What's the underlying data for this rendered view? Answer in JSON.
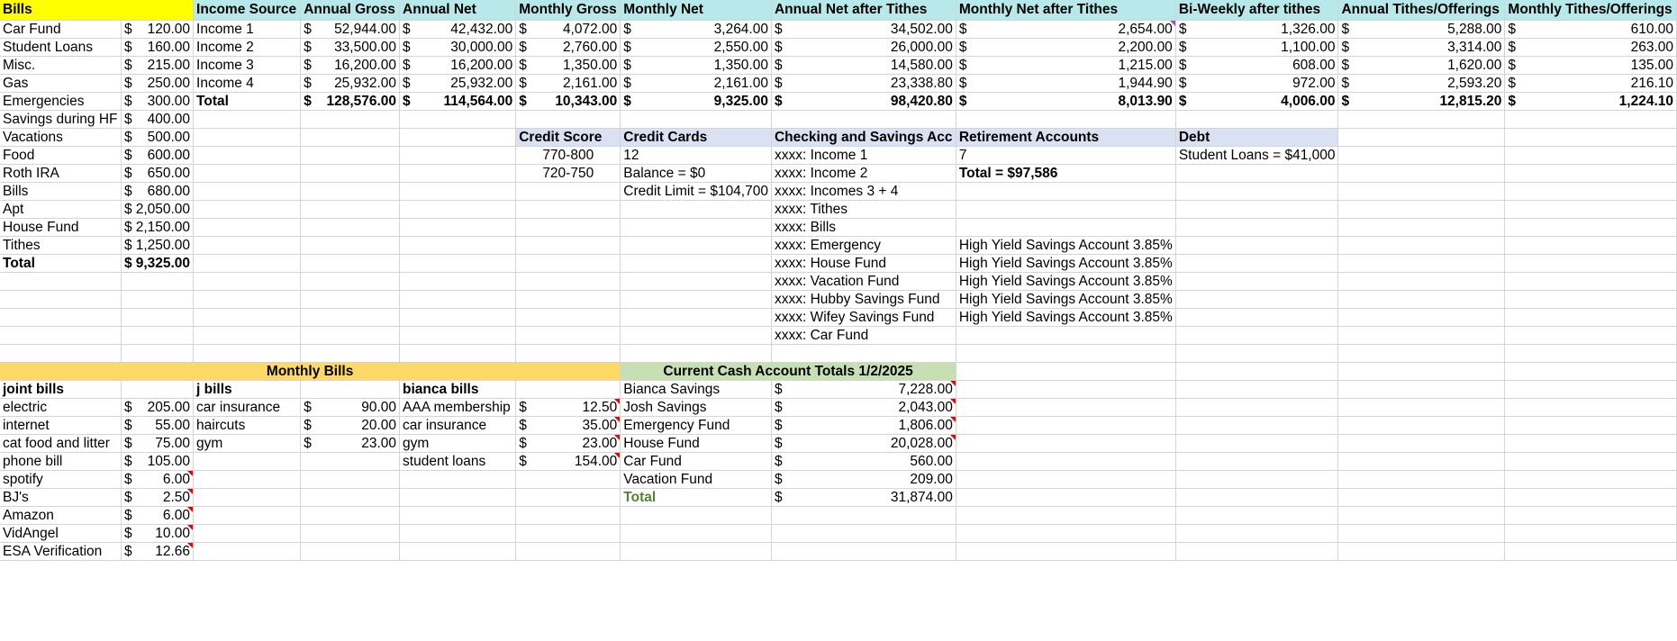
{
  "bills": {
    "header": "Bills",
    "items": [
      {
        "label": "Car Fund",
        "cur": "$",
        "amt": "120.00"
      },
      {
        "label": "Student Loans",
        "cur": "$",
        "amt": "160.00"
      },
      {
        "label": "Misc.",
        "cur": "$",
        "amt": "215.00"
      },
      {
        "label": "Gas",
        "cur": "$",
        "amt": "250.00"
      },
      {
        "label": "Emergencies",
        "cur": "$",
        "amt": "300.00"
      },
      {
        "label": "Savings during HF",
        "cur": "$",
        "amt": "400.00"
      },
      {
        "label": "Vacations",
        "cur": "$",
        "amt": "500.00"
      },
      {
        "label": "Food",
        "cur": "$",
        "amt": "600.00"
      },
      {
        "label": "Roth IRA",
        "cur": "$",
        "amt": "650.00"
      },
      {
        "label": "Bills",
        "cur": "$",
        "amt": "680.00"
      },
      {
        "label": "Apt",
        "cur": "$",
        "amt": "2,050.00"
      },
      {
        "label": "House Fund",
        "cur": "$",
        "amt": "2,150.00"
      },
      {
        "label": "Tithes",
        "cur": "$",
        "amt": "1,250.00"
      }
    ],
    "total_label": "Total",
    "total_cur": "$",
    "total_amt": "9,325.00"
  },
  "income": {
    "headers": [
      "Income Source",
      "Annual Gross",
      "Annual Net",
      "Monthly Gross",
      "Monthly Net",
      "Annual Net after Tithes",
      "Monthly Net after Tithes",
      "Bi-Weekly after tithes",
      "Annual Tithes/Offerings",
      "Monthly Tithes/Offerings"
    ],
    "rows": [
      {
        "source": "Income 1",
        "ag": "52,944.00",
        "an": "42,432.00",
        "mg": "4,072.00",
        "mn": "3,264.00",
        "ant": "34,502.00",
        "mnt": "2,654.00",
        "bw": "1,326.00",
        "at": "5,288.00",
        "mt": "610.00"
      },
      {
        "source": "Income 2",
        "ag": "33,500.00",
        "an": "30,000.00",
        "mg": "2,760.00",
        "mn": "2,550.00",
        "ant": "26,000.00",
        "mnt": "2,200.00",
        "bw": "1,100.00",
        "at": "3,314.00",
        "mt": "263.00"
      },
      {
        "source": "Income 3",
        "ag": "16,200.00",
        "an": "16,200.00",
        "mg": "1,350.00",
        "mn": "1,350.00",
        "ant": "14,580.00",
        "mnt": "1,215.00",
        "bw": "608.00",
        "at": "1,620.00",
        "mt": "135.00"
      },
      {
        "source": "Income 4",
        "ag": "25,932.00",
        "an": "25,932.00",
        "mg": "2,161.00",
        "mn": "2,161.00",
        "ant": "23,338.80",
        "mnt": "1,944.90",
        "bw": "972.00",
        "at": "2,593.20",
        "mt": "216.10"
      }
    ],
    "total": {
      "source": "Total",
      "ag": "128,576.00",
      "an": "114,564.00",
      "mg": "10,343.00",
      "mn": "9,325.00",
      "ant": "98,420.80",
      "mnt": "8,013.90",
      "bw": "4,006.00",
      "at": "12,815.20",
      "mt": "1,224.10"
    },
    "cur": "$"
  },
  "credit": {
    "score_header": "Credit Score",
    "scores": [
      "770-800",
      "720-750"
    ],
    "cards_header": "Credit Cards",
    "cards": [
      "12",
      "Balance = $0",
      "Credit Limit = $104,700"
    ]
  },
  "checking": {
    "header": "Checking and Savings Acc",
    "items": [
      "xxxx: Income 1",
      "xxxx: Income 2",
      "xxxx: Incomes 3 + 4",
      "xxxx: Tithes",
      "xxxx: Bills",
      "xxxx: Emergency",
      "xxxx: House Fund",
      "xxxx: Vacation Fund",
      "xxxx: Hubby Savings Fund",
      "xxxx: Wifey Savings Fund",
      "xxxx: Car Fund"
    ],
    "hysa": "High Yield Savings Account 3.85%"
  },
  "retirement": {
    "header": "Retirement Accounts",
    "count": "7",
    "total": "Total = $97,586"
  },
  "debt": {
    "header": "Debt",
    "item": "Student Loans = $41,000"
  },
  "monthly_bills": {
    "header": "Monthly Bills",
    "joint_header": "joint bills",
    "joint": [
      {
        "label": "electric",
        "amt": "205.00"
      },
      {
        "label": "internet",
        "amt": "55.00"
      },
      {
        "label": "cat food and litter",
        "amt": "75.00"
      },
      {
        "label": "phone bill",
        "amt": "105.00"
      },
      {
        "label": "spotify",
        "amt": "6.00"
      },
      {
        "label": "BJ's",
        "amt": "2.50"
      },
      {
        "label": "Amazon",
        "amt": "6.00"
      },
      {
        "label": "VidAngel",
        "amt": "10.00"
      },
      {
        "label": "ESA Verification",
        "amt": "12.66"
      }
    ],
    "j_header": "j bills",
    "j": [
      {
        "label": "car insurance",
        "amt": "90.00"
      },
      {
        "label": "haircuts",
        "amt": "20.00"
      },
      {
        "label": "gym",
        "amt": "23.00"
      }
    ],
    "b_header": "bianca bills",
    "b": [
      {
        "label": "AAA membership",
        "amt": "12.50"
      },
      {
        "label": "car insurance",
        "amt": "35.00"
      },
      {
        "label": "gym",
        "amt": "23.00"
      },
      {
        "label": "student loans",
        "amt": "154.00"
      }
    ],
    "cur": "$"
  },
  "cash": {
    "header": "Current Cash Account Totals 1/2/2025",
    "items": [
      {
        "label": "Bianca Savings",
        "amt": "7,228.00"
      },
      {
        "label": "Josh Savings",
        "amt": "2,043.00"
      },
      {
        "label": "Emergency Fund",
        "amt": "1,806.00"
      },
      {
        "label": "House Fund",
        "amt": "20,028.00"
      },
      {
        "label": "Car Fund",
        "amt": "560.00"
      },
      {
        "label": "Vacation Fund",
        "amt": "209.00"
      }
    ],
    "total_label": "Total",
    "total_amt": "31,874.00",
    "cur": "$"
  }
}
